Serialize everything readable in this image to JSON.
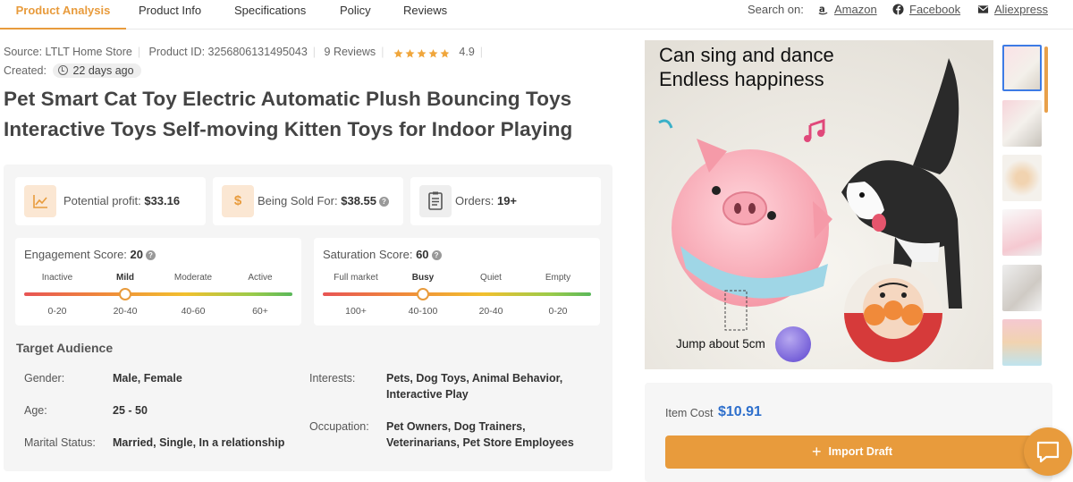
{
  "tabs": [
    "Product Analysis",
    "Product Info",
    "Specifications",
    "Policy",
    "Reviews"
  ],
  "search": {
    "label": "Search on:",
    "amazon": "Amazon",
    "facebook": "Facebook",
    "aliexpress": "Aliexpress"
  },
  "meta": {
    "source": "Source: LTLT Home Store",
    "product_id": "Product ID: 3256806131495043",
    "reviews": "9 Reviews",
    "rating": 4.9,
    "rating_text": "4.9",
    "created_label": "Created:",
    "created_value": "22 days ago"
  },
  "title": "Pet Smart Cat Toy Electric Automatic Plush Bouncing Toys Interactive Toys Self-moving Kitten Toys for Indoor Playing",
  "stats": {
    "profit_label": "Potential profit:",
    "profit_value": "$33.16",
    "sold_label": "Being Sold For:",
    "sold_value": "$38.55",
    "sold_icon": "$",
    "orders_label": "Orders:",
    "orders_value": "19+"
  },
  "engagement": {
    "label": "Engagement Score:",
    "value": "20",
    "levels": [
      "Inactive",
      "Mild",
      "Moderate",
      "Active"
    ],
    "ranges": [
      "0-20",
      "20-40",
      "40-60",
      "60+"
    ],
    "selected_index": 1
  },
  "saturation": {
    "label": "Saturation Score:",
    "value": "60",
    "levels": [
      "Full market",
      "Busy",
      "Quiet",
      "Empty"
    ],
    "ranges": [
      "100+",
      "40-100",
      "20-40",
      "0-20"
    ],
    "selected_index": 1
  },
  "audience": {
    "heading": "Target Audience",
    "gender_label": "Gender:",
    "gender_value": "Male, Female",
    "age_label": "Age:",
    "age_value": "25 - 50",
    "marital_label": "Marital Status:",
    "marital_value": "Married, Single, In a relationship",
    "interests_label": "Interests:",
    "interests_line1": "Pets, Dog Toys, Animal Behavior,",
    "interests_line2": "Interactive Play",
    "occupation_label": "Occupation:",
    "occupation_line1": "Pet Owners, Dog Trainers,",
    "occupation_line2": "Veterinarians, Pet Store Employees"
  },
  "image": {
    "caption_line1": "Can sing and dance",
    "caption_line2": "Endless happiness",
    "caption_bottom": "Jump about 5cm"
  },
  "buy": {
    "cost_label": "Item Cost",
    "cost_value": "$10.91",
    "import_label": "Import Draft"
  },
  "colors": {
    "accent": "#e89b3c",
    "price": "#2e6fcc"
  },
  "icons": {
    "amazon": "amazon-icon",
    "facebook": "facebook-icon",
    "aliexpress": "mail-icon",
    "profit": "chart-icon",
    "orders": "clipboard-icon",
    "chat": "chat-icon"
  }
}
